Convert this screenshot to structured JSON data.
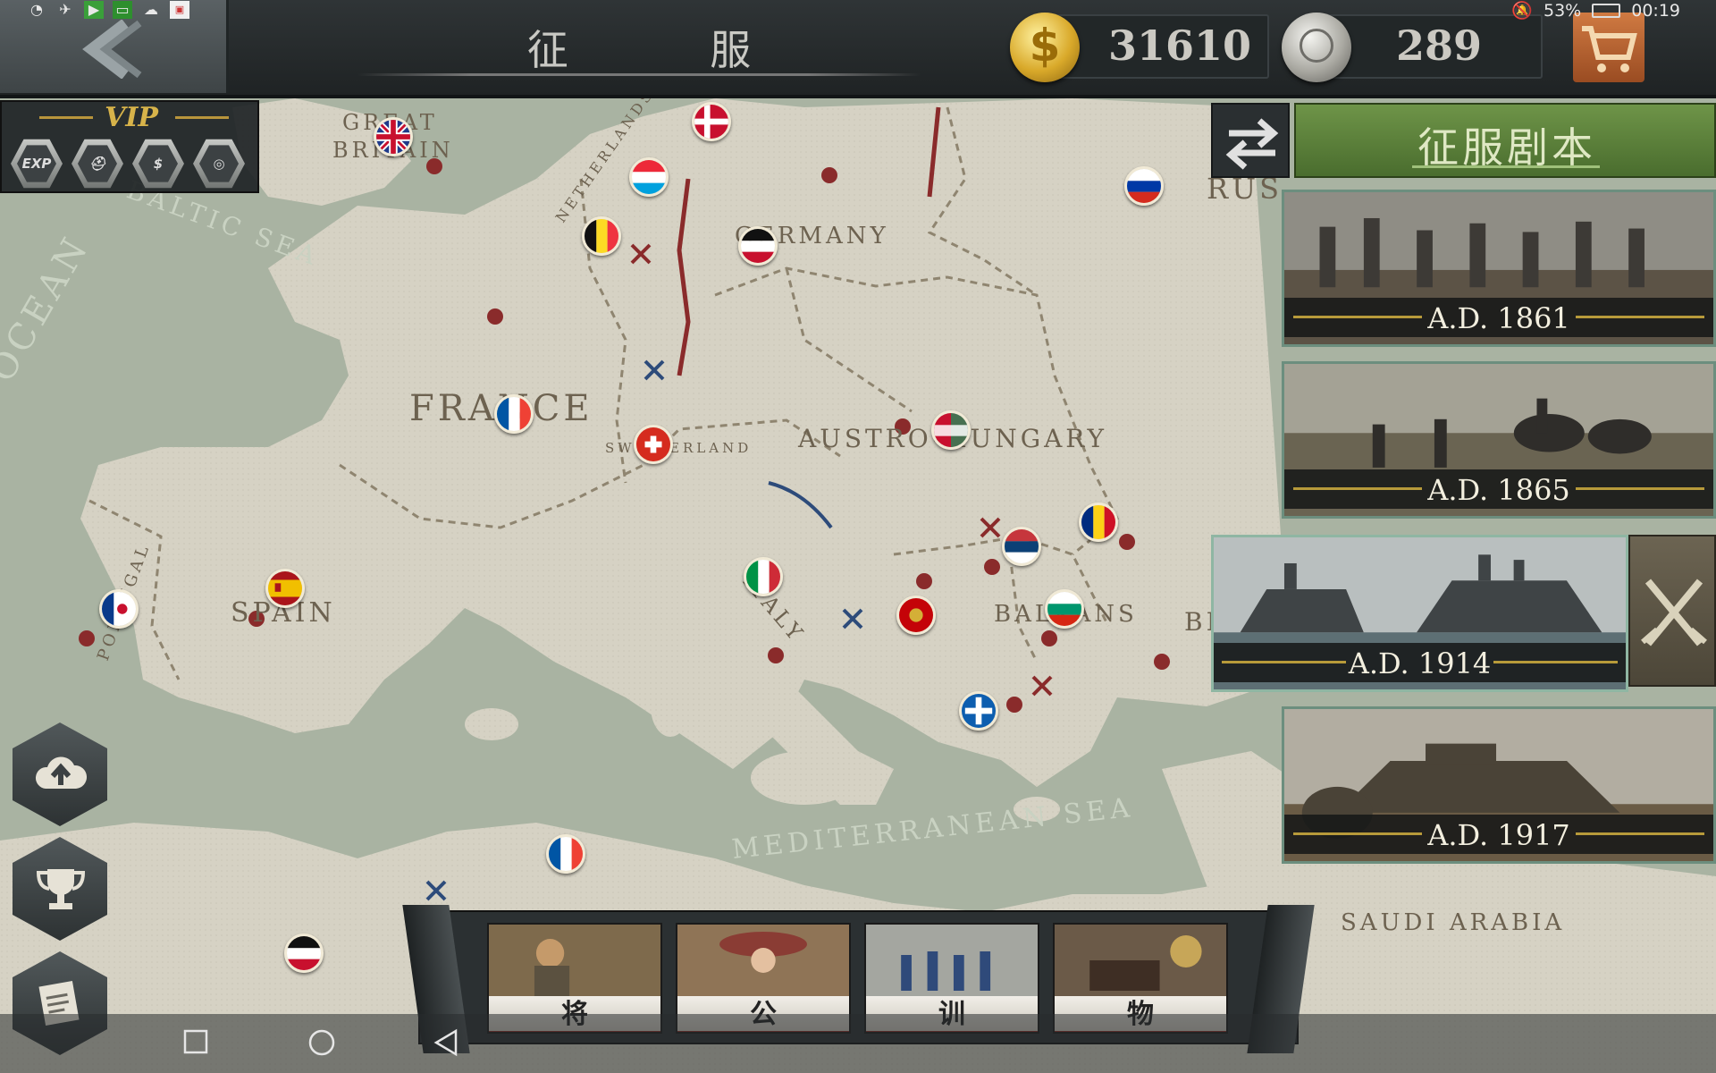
{
  "status_bar": {
    "battery": "53%",
    "time": "00:19"
  },
  "header": {
    "title": "征 服",
    "gold": "31610",
    "medals": "289"
  },
  "vip": {
    "title": "VIP",
    "icons": [
      {
        "icon": "exp-boost-icon",
        "text": "EXP"
      },
      {
        "icon": "helmet-boost-icon",
        "text": ""
      },
      {
        "icon": "coin-boost-icon",
        "text": ""
      },
      {
        "icon": "medal-boost-icon",
        "text": ""
      }
    ]
  },
  "map": {
    "labels": [
      "GREAT BRITAIN",
      "GERMANY",
      "FRANCE",
      "AUSTRO-HUNGARY",
      "SWITZERLAND",
      "SPAIN",
      "PORTUGAL",
      "ITALY",
      "BALKANS",
      "NETHERLANDS",
      "RUS",
      "BL",
      "SAUDI ARABIA"
    ],
    "seas": [
      "OCEAN",
      "BALTIC SEA",
      "MEDITERRANEAN SEA"
    ]
  },
  "scenario_panel": {
    "title": "征服剧本",
    "scenarios": [
      {
        "year": "A.D. 1861"
      },
      {
        "year": "A.D. 1865"
      },
      {
        "year": "A.D. 1914"
      },
      {
        "year": "A.D. 1917"
      }
    ]
  },
  "bottom_menu": [
    "将 领",
    "公 主",
    "训 练",
    "物 品"
  ],
  "colors": {
    "accent_green": "#5a7f3a",
    "gold": "#d9a92a",
    "band_gold": "#b79a3a"
  }
}
